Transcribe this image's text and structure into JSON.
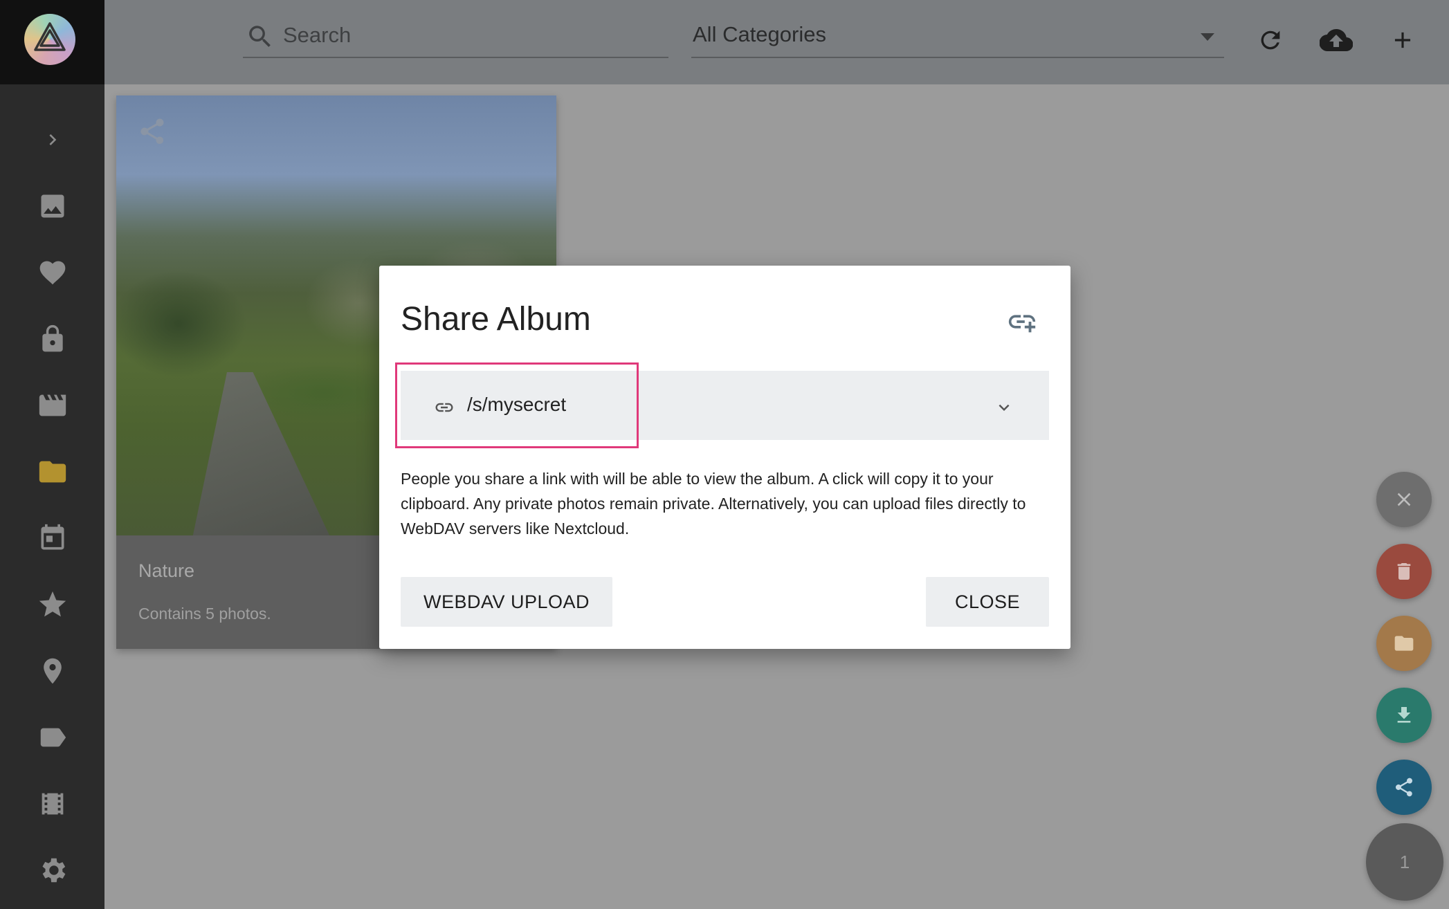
{
  "topbar": {
    "search_placeholder": "Search",
    "category_label": "All Categories"
  },
  "sidebar": {
    "items": [
      {
        "icon": "chevron-right-icon"
      },
      {
        "icon": "image-icon"
      },
      {
        "icon": "heart-icon"
      },
      {
        "icon": "lock-icon"
      },
      {
        "icon": "video-icon"
      },
      {
        "icon": "folder-icon"
      },
      {
        "icon": "calendar-icon"
      },
      {
        "icon": "star-icon"
      },
      {
        "icon": "place-icon"
      },
      {
        "icon": "label-icon"
      },
      {
        "icon": "film-folder-icon"
      },
      {
        "icon": "settings-icon"
      }
    ]
  },
  "album": {
    "title": "Nature",
    "caption": "Contains 5 photos."
  },
  "dialog": {
    "title": "Share Album",
    "link_value": "/s/mysecret",
    "description": "People you share a link with will be able to view the album. A click will copy it to your clipboard. Any private photos remain private. Alternatively, you can upload files directly to WebDAV servers like Nextcloud.",
    "webdav_label": "WEBDAV UPLOAD",
    "close_label": "CLOSE"
  },
  "fab": {
    "count": "1"
  },
  "colors": {
    "highlight": "#e0397a",
    "delete": "#9a4a3e",
    "folder": "#a3794a",
    "download": "#2a7a6c",
    "share": "#1f5d7a"
  }
}
